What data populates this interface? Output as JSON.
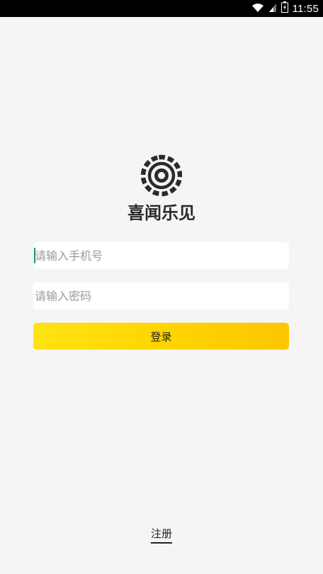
{
  "status_bar": {
    "time": "11:55",
    "icons": [
      "wifi-icon",
      "signal-icon",
      "battery-icon"
    ]
  },
  "app": {
    "logo_text": "喜闻乐见"
  },
  "login_form": {
    "phone_placeholder": "请输入手机号",
    "phone_value": "",
    "password_placeholder": "请输入密码",
    "password_value": "",
    "login_label": "登录"
  },
  "footer": {
    "register_label": "注册"
  },
  "colors": {
    "background": "#f5f5f5",
    "button_start": "#ffe312",
    "button_end": "#fcc600",
    "cursor": "#1e8f88",
    "logo": "#2b2b2b"
  }
}
